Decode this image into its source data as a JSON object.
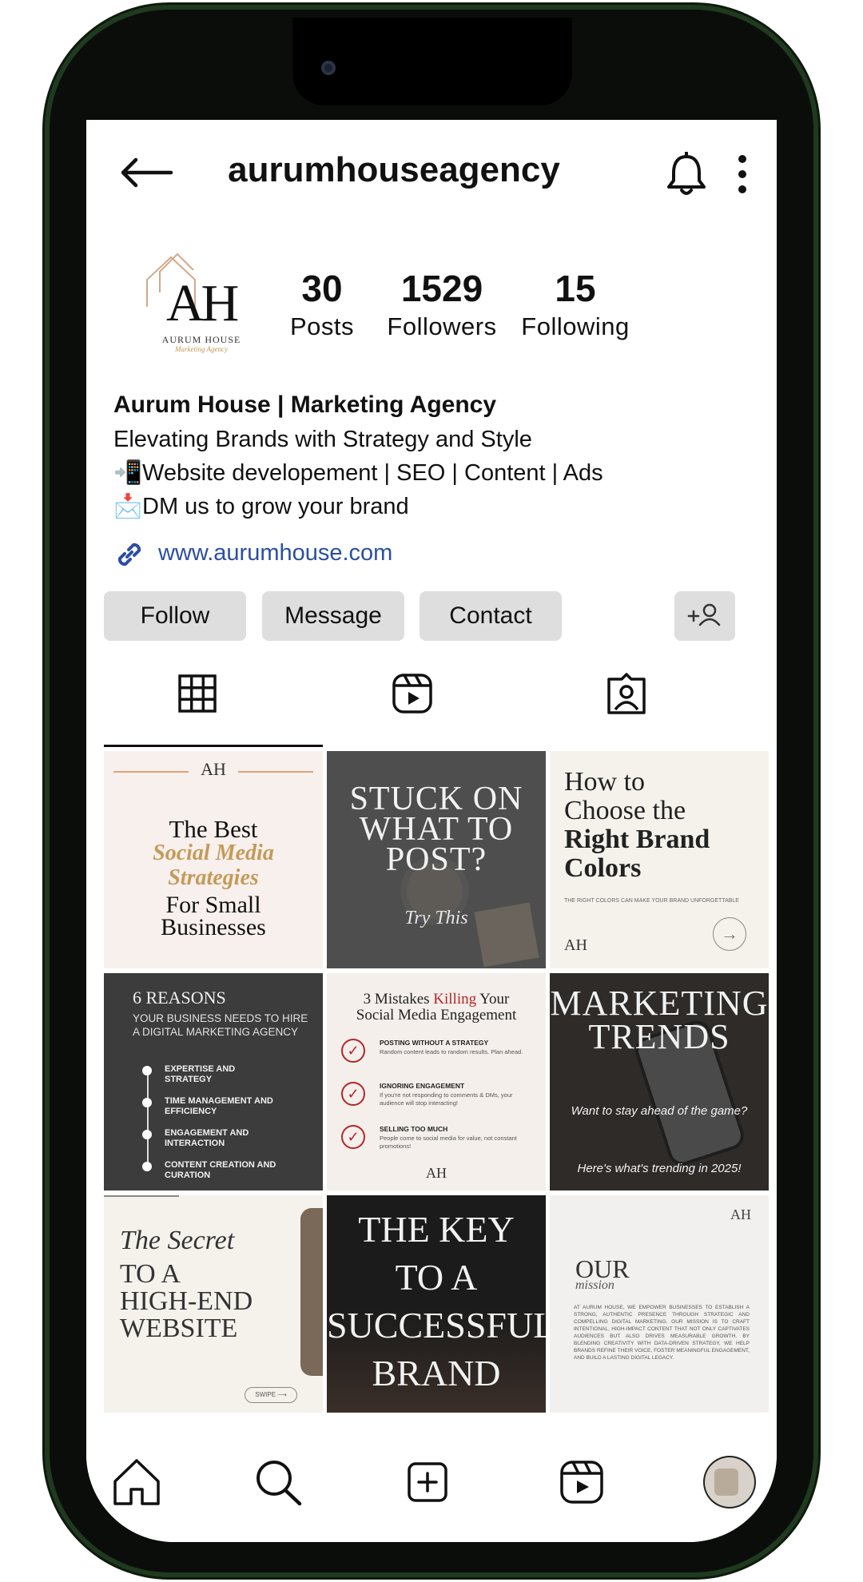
{
  "header": {
    "username": "aurumhouseagency"
  },
  "profile": {
    "logo_initials": "AH",
    "logo_name": "AURUM HOUSE",
    "logo_tagline": "Marketing Agency",
    "stats": [
      {
        "value": "30",
        "label": "Posts"
      },
      {
        "value": "1529",
        "label": "Followers"
      },
      {
        "value": "15",
        "label": "Following"
      }
    ],
    "display_name": "Aurum House | Marketing Agency",
    "bio_lines": [
      {
        "emoji": "",
        "text": "Elevating Brands with Strategy and Style"
      },
      {
        "emoji": "📲",
        "text": "Website developement | SEO | Content | Ads"
      },
      {
        "emoji": "📩",
        "text": "DM us to grow your brand"
      }
    ],
    "website": "www.aurumhouse.com"
  },
  "actions": {
    "follow": "Follow",
    "message": "Message",
    "contact": "Contact"
  },
  "tabs": [
    "grid-icon",
    "reels-icon",
    "tagged-icon"
  ],
  "posts": {
    "p1": {
      "logo": "AH",
      "line1": "The Best",
      "line2": "Social Media",
      "line3": "Strategies",
      "line4": "For Small",
      "line5": "Businesses"
    },
    "p2": {
      "line1": "STUCK ON",
      "line2": "WHAT TO",
      "line3": "POST?",
      "line4": "Try This"
    },
    "p3": {
      "line1": "How to",
      "line2": "Choose the",
      "line3": "Right Brand",
      "line4": "Colors",
      "caption": "THE RIGHT COLORS CAN MAKE YOUR BRAND UNFORGETTABLE",
      "logo": "AH"
    },
    "p4": {
      "title": "6 REASONS",
      "subtitle": "YOUR BUSINESS NEEDS TO HIRE A DIGITAL MARKETING AGENCY",
      "items": [
        "EXPERTISE AND STRATEGY",
        "TIME MANAGEMENT AND EFFICIENCY",
        "ENGAGEMENT AND INTERACTION",
        "CONTENT CREATION AND CURATION"
      ]
    },
    "p5": {
      "title_a": "3 Mistakes ",
      "title_b": "Killing",
      "title_c": " Your",
      "title_d": "Social Media Engagement",
      "items": [
        {
          "head": "POSTING WITHOUT A STRATEGY",
          "body": "Random content leads to random results. Plan ahead."
        },
        {
          "head": "IGNORING ENGAGEMENT",
          "body": "If you're not responding to comments & DMs, your audience will stop interacting!"
        },
        {
          "head": "SELLING TOO MUCH",
          "body": "People come to social media for value, not constant promotions!"
        }
      ],
      "logo": "AH"
    },
    "p6": {
      "line1": "MARKETING",
      "line2": "TRENDS",
      "line3": "Want to stay ahead of the game?",
      "line4": "Here's what's trending in 2025!"
    },
    "p7": {
      "line1": "The Secret",
      "line2": "TO A",
      "line3": "HIGH-END",
      "line4": "WEBSITE",
      "swipe": "SWIPE"
    },
    "p8": {
      "line1": "THE KEY",
      "line2": "TO A",
      "line3": "SUCCESSFUL",
      "line4": "BRAND"
    },
    "p9": {
      "logo": "AH",
      "line1": "OUR",
      "line2": "mission",
      "body": "AT AURUM HOUSE, WE EMPOWER BUSINESSES TO ESTABLISH A STRONG, AUTHENTIC PRESENCE THROUGH STRATEGIC AND COMPELLING DIGITAL MARKETING. OUR MISSION IS TO CRAFT INTENTIONAL, HIGH-IMPACT CONTENT THAT NOT ONLY CAPTIVATES AUDIENCES BUT ALSO DRIVES MEASURABLE GROWTH. BY BLENDING CREATIVITY WITH DATA-DRIVEN STRATEGY, WE HELP BRANDS REFINE THEIR VOICE, FOSTER MEANINGFUL ENGAGEMENT, AND BUILD A LASTING DIGITAL LEGACY."
    }
  },
  "bottom_nav": [
    "home-icon",
    "search-icon",
    "new-post-icon",
    "reels-icon",
    "profile-avatar"
  ],
  "colors": {
    "link": "#2b4fa0",
    "button_bg": "#dedede",
    "gold": "#c49a5a",
    "red": "#b3262b"
  }
}
